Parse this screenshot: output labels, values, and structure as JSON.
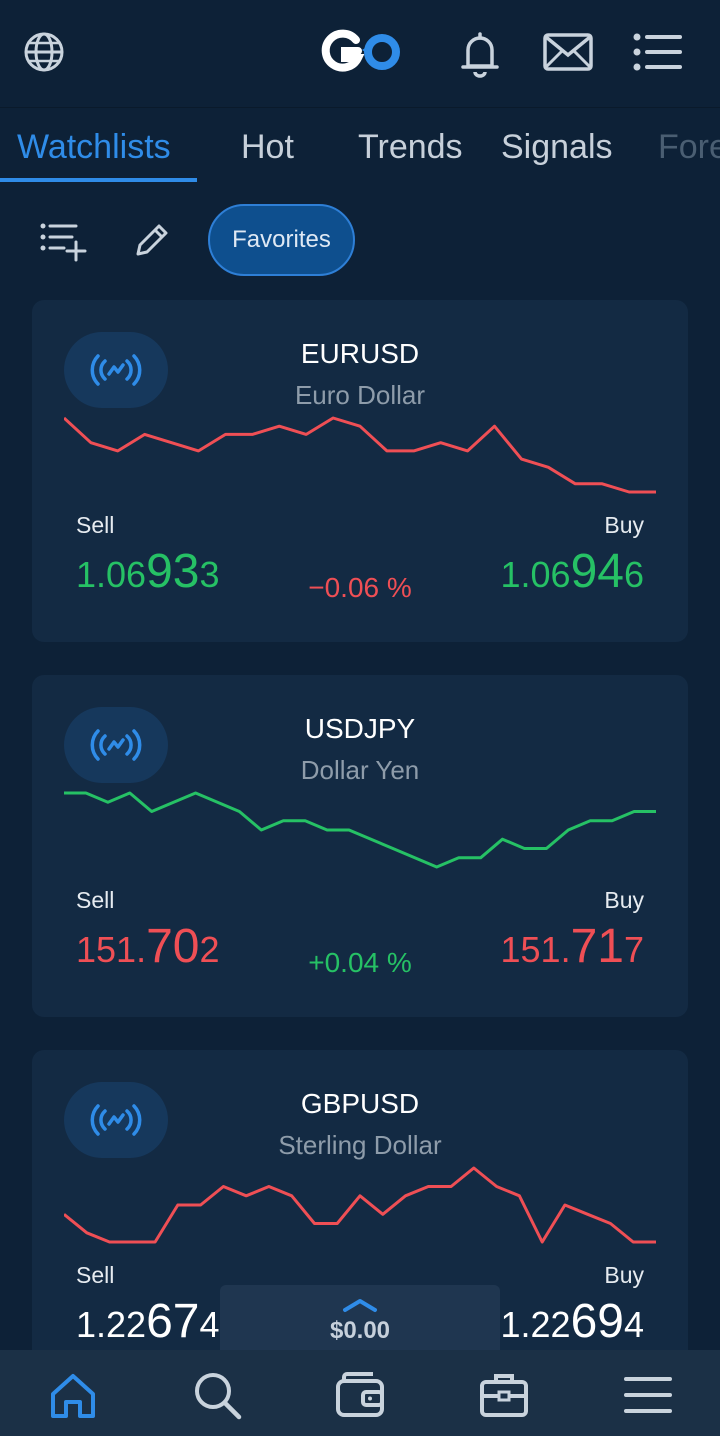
{
  "header": {
    "icons": [
      "globe-icon",
      "go-logo",
      "bell-icon",
      "mail-icon",
      "menu-list-icon"
    ],
    "brand_color": "#ffffff",
    "accent_color": "#2f8ce8"
  },
  "tabs": [
    {
      "label": "Watchlists",
      "active": true
    },
    {
      "label": "Hot",
      "active": false
    },
    {
      "label": "Trends",
      "active": false
    },
    {
      "label": "Signals",
      "active": false
    },
    {
      "label": "Fore",
      "active": false
    }
  ],
  "toolbar": {
    "favorites_label": "Favorites"
  },
  "instruments": [
    {
      "symbol": "EURUSD",
      "description": "Euro  Dollar",
      "sell_label": "Sell",
      "buy_label": "Buy",
      "sell_prefix": "1.06",
      "sell_big": "93",
      "sell_suffix": "3",
      "buy_prefix": "1.06",
      "buy_big": "94",
      "buy_suffix": "6",
      "change": "−0.06 %",
      "price_color": "#26c165",
      "change_color": "#ef4f55",
      "sparkline_color": "#ef4f55",
      "sparkline": [
        1.0702,
        1.0699,
        1.0698,
        1.07,
        1.0699,
        1.0698,
        1.07,
        1.07,
        1.0701,
        1.07,
        1.0702,
        1.0701,
        1.0698,
        1.0698,
        1.0699,
        1.0698,
        1.0701,
        1.0697,
        1.0696,
        1.0694,
        1.0694,
        1.0693,
        1.0693
      ]
    },
    {
      "symbol": "USDJPY",
      "description": "Dollar Yen",
      "sell_label": "Sell",
      "buy_label": "Buy",
      "sell_prefix": "151.",
      "sell_big": "70",
      "sell_suffix": "2",
      "buy_prefix": "151.",
      "buy_big": "71",
      "buy_suffix": "7",
      "change": "+0.04 %",
      "price_color": "#ef4f55",
      "change_color": "#26c165",
      "sparkline_color": "#26c165",
      "sparkline": [
        151.76,
        151.76,
        151.75,
        151.76,
        151.74,
        151.75,
        151.76,
        151.75,
        151.74,
        151.72,
        151.73,
        151.73,
        151.72,
        151.72,
        151.71,
        151.7,
        151.69,
        151.68,
        151.69,
        151.69,
        151.71,
        151.7,
        151.7,
        151.72,
        151.73,
        151.73,
        151.74,
        151.74
      ]
    },
    {
      "symbol": "GBPUSD",
      "description": "Sterling Dollar",
      "sell_label": "Sell",
      "buy_label": "Buy",
      "sell_prefix": "1.22",
      "sell_big": "67",
      "sell_suffix": "4",
      "buy_prefix": "1.22",
      "buy_big": "69",
      "buy_suffix": "4",
      "change": "",
      "price_color": "#ffffff",
      "change_color": "#26c165",
      "sparkline_color": "#ef4f55",
      "sparkline": [
        1.2275,
        1.2273,
        1.2272,
        1.2272,
        1.2272,
        1.2276,
        1.2276,
        1.2278,
        1.2277,
        1.2278,
        1.2277,
        1.2274,
        1.2274,
        1.2277,
        1.2275,
        1.2277,
        1.2278,
        1.2278,
        1.228,
        1.2278,
        1.2277,
        1.2272,
        1.2276,
        1.2275,
        1.2274,
        1.2272,
        1.2272
      ]
    }
  ],
  "balance": {
    "amount": "$0.00"
  },
  "bottom_nav": [
    {
      "name": "home-icon",
      "active": true
    },
    {
      "name": "search-icon",
      "active": false
    },
    {
      "name": "wallet-icon",
      "active": false
    },
    {
      "name": "portfolio-icon",
      "active": false
    },
    {
      "name": "hamburger-menu-icon",
      "active": false
    }
  ]
}
